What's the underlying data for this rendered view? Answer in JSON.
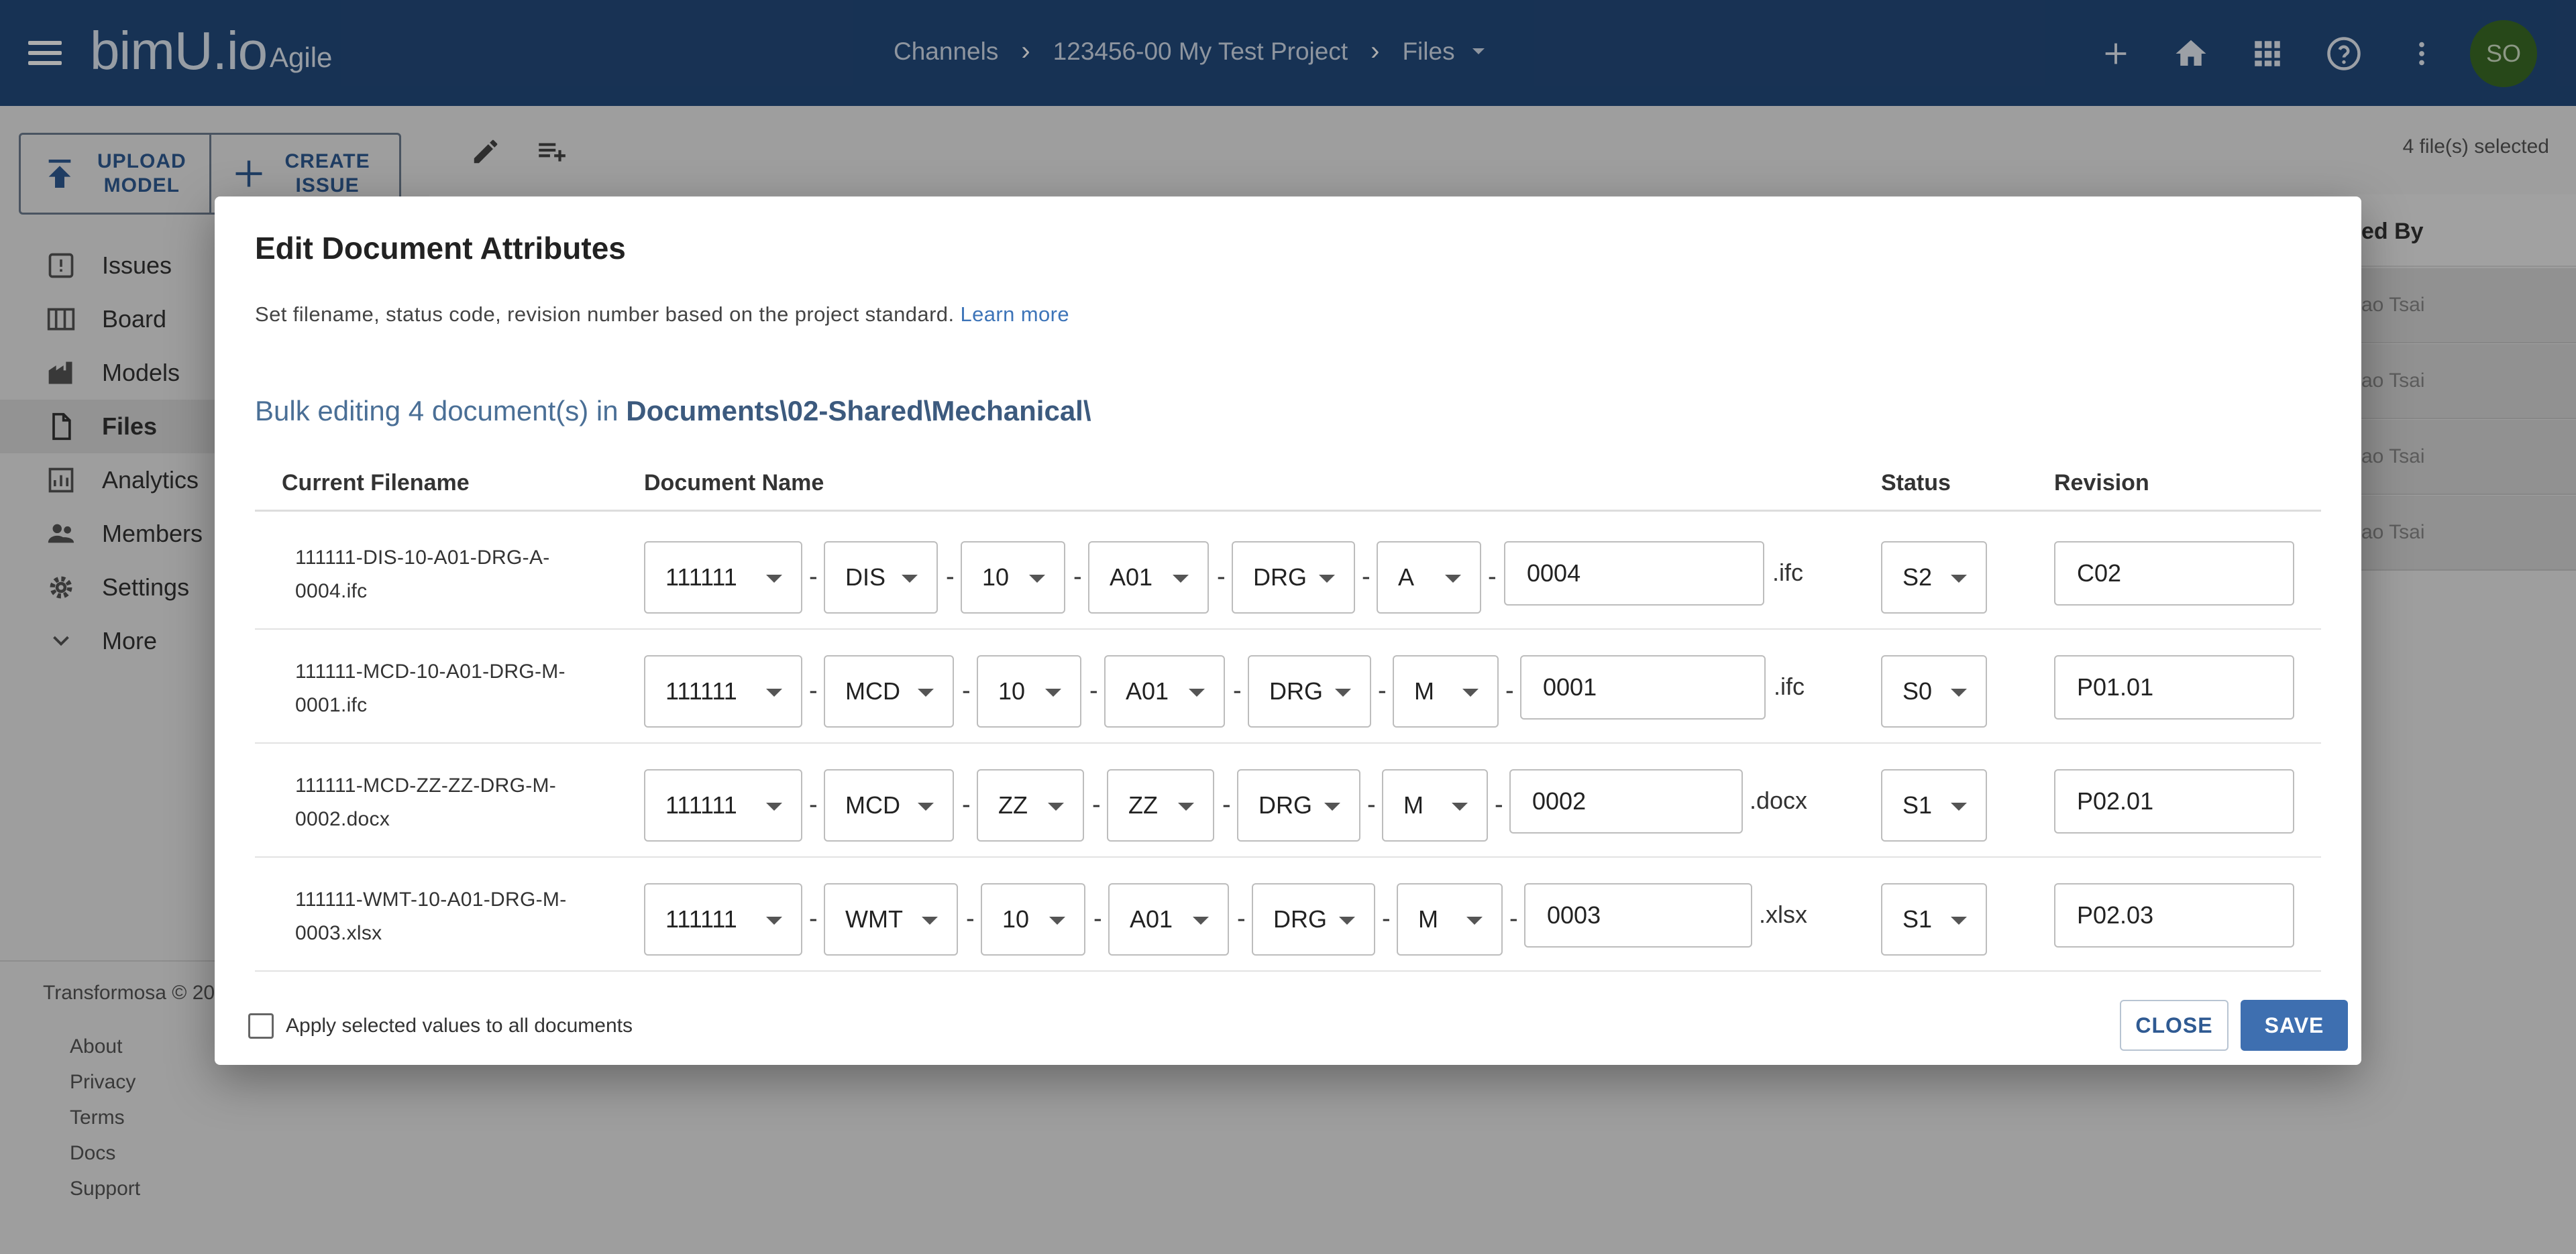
{
  "app": {
    "logo": "bimU.io",
    "logo_sub": "Agile",
    "breadcrumbs": [
      "Channels",
      "123456-00 My Test Project",
      "Files"
    ],
    "avatar_initials": "SO",
    "icons": [
      "plus-icon",
      "home-icon",
      "apps-grid-icon",
      "help-icon",
      "more-vert-icon"
    ]
  },
  "sidebar": {
    "upload_label": "UPLOAD\nMODEL",
    "create_label": "CREATE\nISSUE",
    "items": [
      {
        "label": "Issues",
        "icon": "issues-icon"
      },
      {
        "label": "Board",
        "icon": "board-icon"
      },
      {
        "label": "Models",
        "icon": "models-icon"
      },
      {
        "label": "Files",
        "icon": "files-icon"
      },
      {
        "label": "Analytics",
        "icon": "analytics-icon"
      },
      {
        "label": "Members",
        "icon": "members-icon"
      },
      {
        "label": "Settings",
        "icon": "settings-icon"
      },
      {
        "label": "More",
        "icon": "chevron-down-icon"
      }
    ],
    "footer": "Transformosa © 20",
    "links": [
      "About",
      "Privacy",
      "Terms",
      "Docs",
      "Support"
    ]
  },
  "main": {
    "selected_count": "4 file(s) selected",
    "column_partial": "ed By",
    "rows": [
      "ao Tsai",
      "ao Tsai",
      "ao Tsai",
      "ao Tsai"
    ]
  },
  "dialog": {
    "title": "Edit Document Attributes",
    "description": "Set filename, status code, revision number based on the project standard.",
    "learn_more": "Learn more",
    "bulk_prefix": "Bulk editing 4 document(s) in",
    "bulk_path": "Documents\\02-Shared\\Mechanical\\",
    "columns": {
      "current_filename": "Current Filename",
      "document_name": "Document Name",
      "status": "Status",
      "revision": "Revision"
    },
    "rows": [
      {
        "filename": "111111-DIS-10-A01-DRG-A-0004.ifc",
        "project": "111111",
        "originator": "DIS",
        "zone": "10",
        "level": "A01",
        "type": "DRG",
        "role": "A",
        "number": "0004",
        "ext": ".ifc",
        "status": "S2",
        "revision": "C02"
      },
      {
        "filename": "111111-MCD-10-A01-DRG-M-0001.ifc",
        "project": "111111",
        "originator": "MCD",
        "zone": "10",
        "level": "A01",
        "type": "DRG",
        "role": "M",
        "number": "0001",
        "ext": ".ifc",
        "status": "S0",
        "revision": "P01.01"
      },
      {
        "filename": "111111-MCD-ZZ-ZZ-DRG-M-0002.docx",
        "project": "111111",
        "originator": "MCD",
        "zone": "ZZ",
        "level": "ZZ",
        "type": "DRG",
        "role": "M",
        "number": "0002",
        "ext": ".docx",
        "status": "S1",
        "revision": "P02.01"
      },
      {
        "filename": "111111-WMT-10-A01-DRG-M-0003.xlsx",
        "project": "111111",
        "originator": "WMT",
        "zone": "10",
        "level": "A01",
        "type": "DRG",
        "role": "M",
        "number": "0003",
        "ext": ".xlsx",
        "status": "S1",
        "revision": "P02.03"
      }
    ],
    "dash": "-",
    "apply_label": "Apply selected values to all documents",
    "close_label": "CLOSE",
    "save_label": "SAVE"
  }
}
